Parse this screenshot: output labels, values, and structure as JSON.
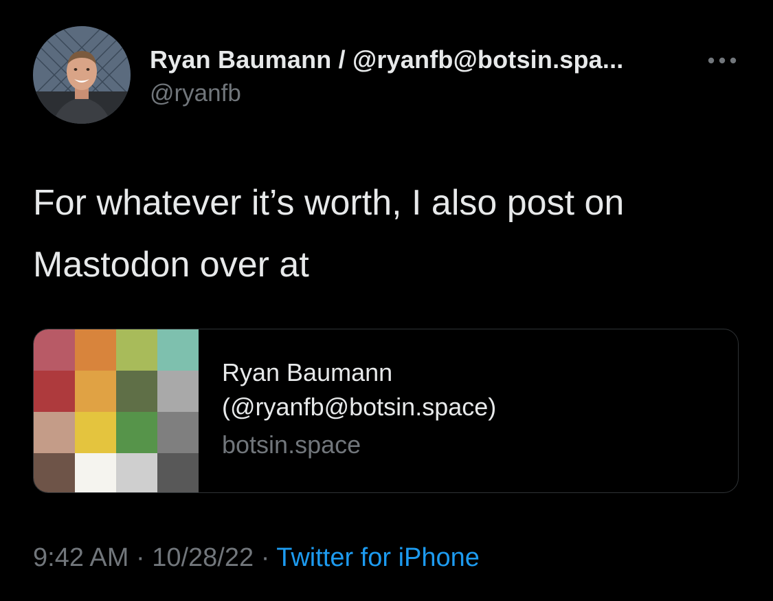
{
  "tweet": {
    "author": {
      "display_name": "Ryan Baumann / @ryanfb@botsin.spa...",
      "handle": "@ryanfb"
    },
    "text_line1": "For whatever it’s worth, I also post on",
    "text_line2": "Mastodon over at",
    "card": {
      "title_line1": "Ryan Baumann",
      "title_line2": "(@ryanfb@botsin.space)",
      "domain": "botsin.space",
      "thumbnail_colors": [
        "#b85a66",
        "#d8843c",
        "#a8bb5a",
        "#7ec0ae",
        "#ae3a3d",
        "#e0a244",
        "#5f6f47",
        "#a9a9a9",
        "#c49c88",
        "#e4c43e",
        "#56944a",
        "#7f7f7f",
        "#6e5448",
        "#f5f4ef",
        "#cfcfcf",
        "#585858"
      ]
    },
    "time": "9:42 AM",
    "date": "10/28/22",
    "separator": "·",
    "source": "Twitter for iPhone"
  },
  "icons": {
    "more": "more-horizontal-icon"
  },
  "colors": {
    "background": "#000000",
    "primary_text": "#e7e9ea",
    "secondary_text": "#71767b",
    "link": "#1d9bf0",
    "border": "#2f3336"
  }
}
